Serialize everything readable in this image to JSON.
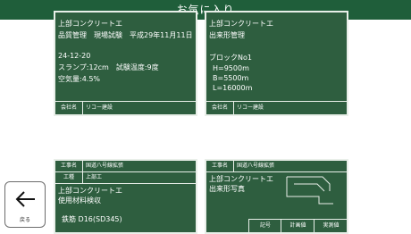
{
  "header": {
    "title": "お気に入り"
  },
  "cards": [
    {
      "lines": [
        "上部コンクリートエ",
        "品質管理　現場試験　平成29年11月11日",
        "",
        "24-12-20",
        "スランプ:12cm　試験温度:9度",
        "空気量:4.5%"
      ],
      "footer": {
        "key": "会社名",
        "value": "リコー建設"
      }
    },
    {
      "lines": [
        "上部コンクリートエ",
        "出来形管理",
        "",
        "ブロックNo1",
        "H=9500m",
        "B=5500m",
        "L=16000m"
      ],
      "footer": {
        "key": "会社名",
        "value": "リコー建設"
      }
    },
    {
      "header_rows": [
        {
          "key": "工事名",
          "value": "国道八号線拡張"
        },
        {
          "key": "工種",
          "value": "上部工"
        }
      ],
      "lines": [
        "上部コンクリートエ",
        "使用材料検収",
        "",
        "鉄筋 D16(SD345)"
      ]
    },
    {
      "header_rows": [
        {
          "key": "工事名",
          "value": "国道八号線拡張"
        }
      ],
      "lines": [
        "上部コンクリートエ",
        "出来形写真"
      ],
      "table_headers": [
        "記号",
        "計画値",
        "実測値"
      ]
    }
  ],
  "back_button": {
    "label": "戻る"
  }
}
